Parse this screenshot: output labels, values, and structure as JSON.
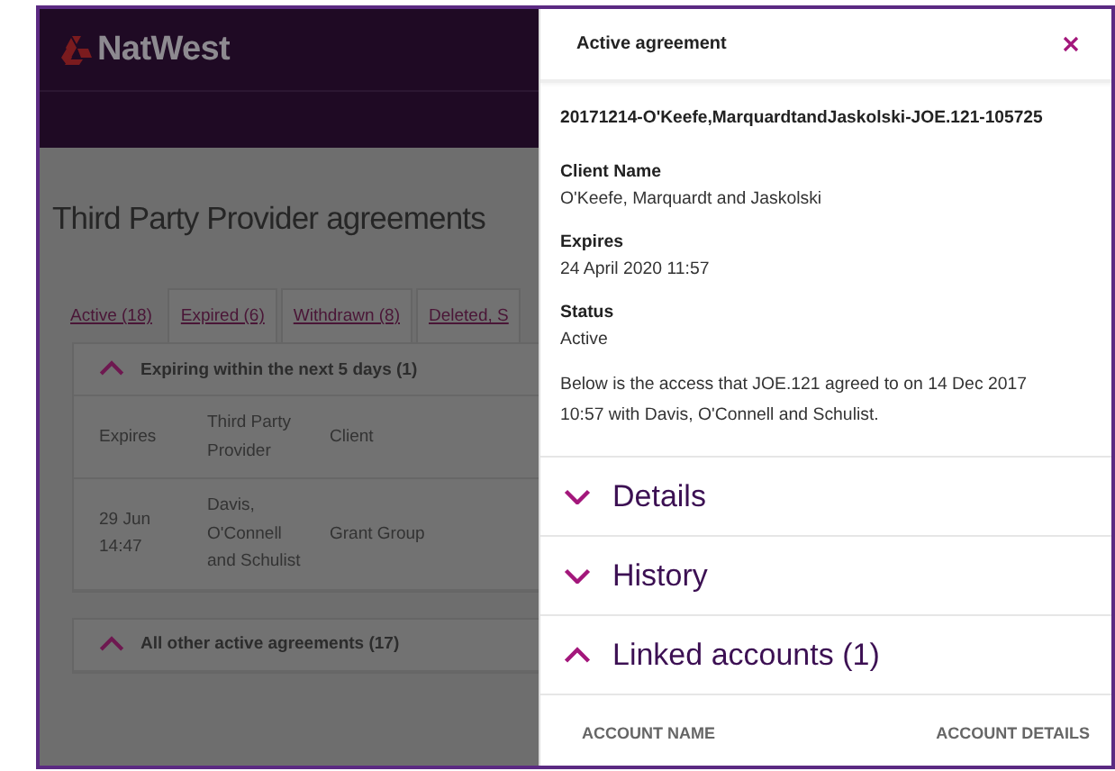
{
  "brand": {
    "name": "NatWest"
  },
  "page_title": "Third Party Provider agreements",
  "tabs": [
    {
      "label": "Active (18)",
      "selected": true
    },
    {
      "label": "Expired (6)",
      "selected": false
    },
    {
      "label": "Withdrawn (8)",
      "selected": false
    },
    {
      "label": "Deleted, S",
      "selected": false
    }
  ],
  "sections": [
    {
      "title": "Expiring within the next 5 days (1)",
      "expanded": true,
      "columns": [
        "Expires",
        "Third Party Provider",
        "Client"
      ],
      "rows": [
        [
          "29 Jun 14:47",
          "Davis, O'Connell and Schulist",
          "Grant Group"
        ]
      ]
    },
    {
      "title": "All other active agreements (17)",
      "expanded": true
    }
  ],
  "drawer": {
    "title": "Active agreement",
    "agreement_id": "20171214-O'Keefe,MarquardtandJaskolski-JOE.121-105725",
    "fields": [
      {
        "label": "Client Name",
        "value": "O'Keefe, Marquardt and Jaskolski"
      },
      {
        "label": "Expires",
        "value": "24 April 2020 11:57"
      },
      {
        "label": "Status",
        "value": "Active"
      }
    ],
    "description": "Below is the access that JOE.121 agreed to on 14 Dec 2017 10:57 with Davis, O'Connell and Schulist.",
    "accordions": [
      {
        "label": "Details",
        "expanded": false
      },
      {
        "label": "History",
        "expanded": false
      },
      {
        "label": "Linked accounts (1)",
        "expanded": true
      }
    ],
    "linked_accounts": {
      "columns": [
        "ACCOUNT NAME",
        "ACCOUNT DETAILS"
      ]
    }
  }
}
